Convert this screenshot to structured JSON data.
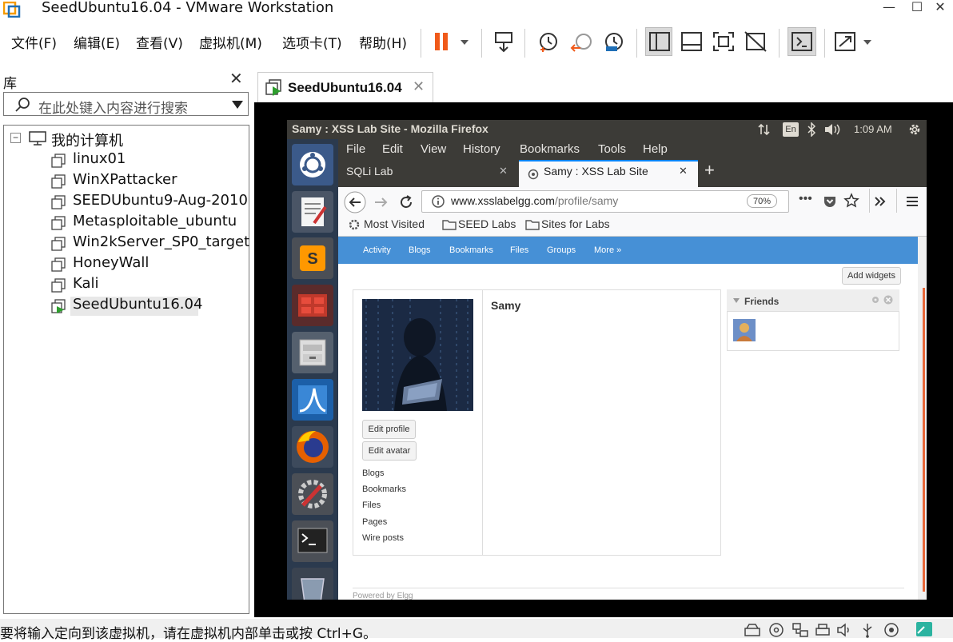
{
  "window": {
    "title": "SeedUbuntu16.04 - VMware Workstation",
    "minimize": "—",
    "maximize": "☐",
    "close": "✕"
  },
  "menu": {
    "items": [
      "文件(F)",
      "编辑(E)",
      "查看(V)",
      "虚拟机(M)",
      "选项卡(T)",
      "帮助(H)"
    ]
  },
  "library": {
    "title": "库",
    "close": "✕",
    "search_placeholder": "在此处键入内容进行搜索",
    "root_toggle": "−",
    "root": "我的计算机",
    "vms": [
      "linux01",
      "WinXPattacker",
      "SEEDUbuntu9-Aug-2010",
      "Metasploitable_ubuntu",
      "Win2kServer_SP0_target",
      "HoneyWall",
      "Kali",
      "SeedUbuntu16.04"
    ]
  },
  "vm_tab": {
    "label": "SeedUbuntu16.04",
    "close": "✕"
  },
  "guest": {
    "topbar_title": "Samy : XSS Lab Site - Mozilla Firefox",
    "keyboard": "En",
    "clock": "1:09 AM",
    "ff_menu": [
      "File",
      "Edit",
      "View",
      "History",
      "Bookmarks",
      "Tools",
      "Help"
    ],
    "tabs": [
      {
        "label": "SQLi Lab",
        "close": "✕"
      },
      {
        "label": "Samy : XSS Lab Site",
        "close": "✕"
      }
    ],
    "new_tab": "+",
    "url_host": "www.xsslabelgg.com",
    "url_path": "/profile/samy",
    "zoom": "70%",
    "bookmarks": [
      "Most Visited",
      "SEED Labs",
      "Sites for Labs"
    ],
    "elgg_nav": [
      "Activity",
      "Blogs",
      "Bookmarks",
      "Files",
      "Groups",
      "More »"
    ],
    "add_widgets": "Add widgets",
    "profile_name": "Samy",
    "edit_profile": "Edit profile",
    "edit_avatar": "Edit avatar",
    "side_links": [
      "Blogs",
      "Bookmarks",
      "Files",
      "Pages",
      "Wire posts"
    ],
    "friends_title": "Friends",
    "footer": "Powered by Elgg"
  },
  "statusbar": {
    "text": "要将输入定向到该虚拟机，请在虚拟机内部单击或按 Ctrl+G。"
  }
}
